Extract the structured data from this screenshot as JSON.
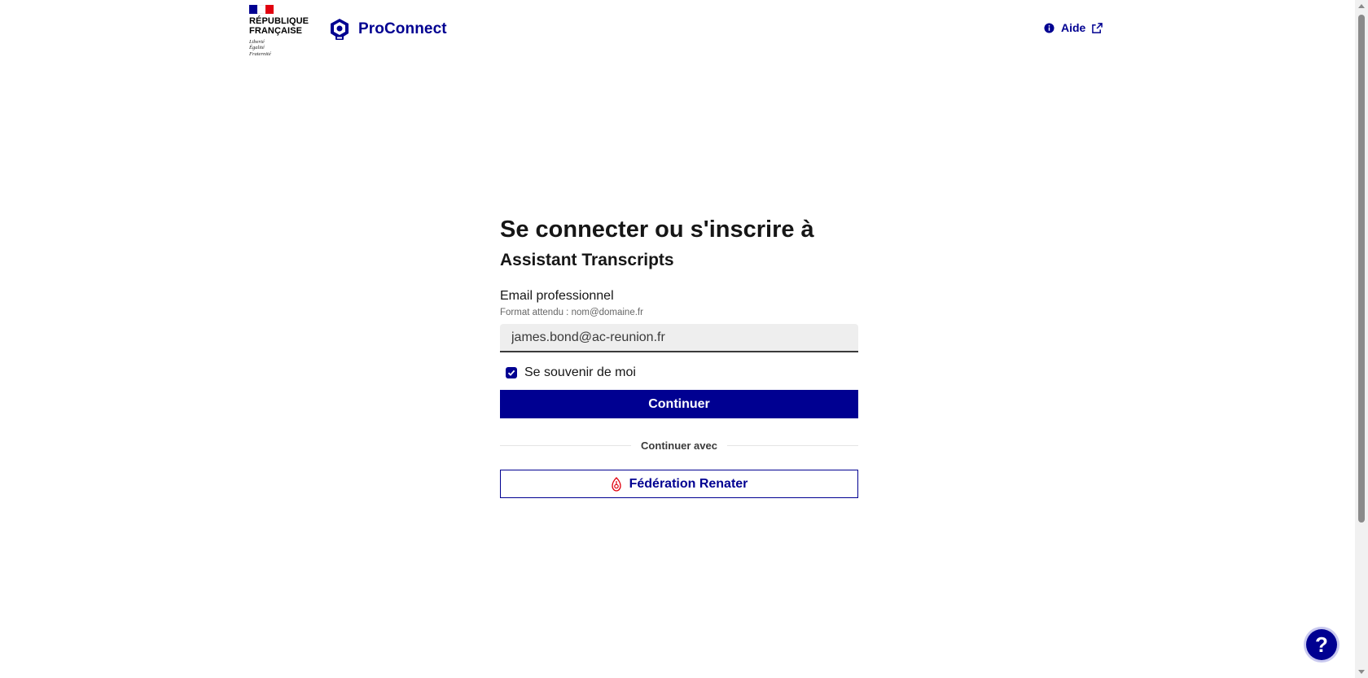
{
  "header": {
    "republic_name_line1": "République",
    "republic_name_line2": "Française",
    "motto": [
      "Liberté",
      "Égalité",
      "Fraternité"
    ],
    "brand_name": "ProConnect",
    "help_label": "Aide"
  },
  "form": {
    "title": "Se connecter ou s'inscrire à",
    "subtitle": "Assistant Transcripts",
    "email_label": "Email professionnel",
    "email_hint": "Format attendu : nom@domaine.fr",
    "email_value": "james.bond@ac-reunion.fr",
    "remember_label": "Se souvenir de moi",
    "remember_checked": true,
    "continue_label": "Continuer",
    "separator_label": "Continuer avec",
    "federation_label": "Fédération Renater"
  },
  "fab": {
    "label": "?"
  },
  "colors": {
    "primary": "#000091",
    "text": "#161616",
    "input_bg": "#eeeeee",
    "flag_blue": "#000091",
    "flag_red": "#e1000f"
  }
}
